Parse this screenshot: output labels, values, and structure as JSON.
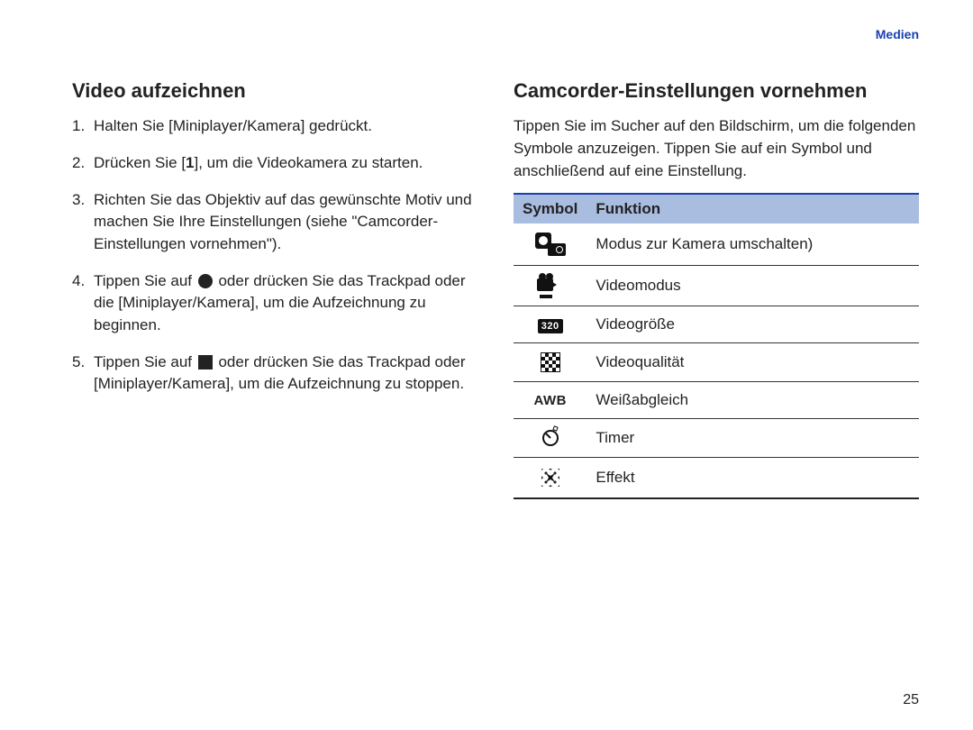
{
  "header": {
    "section_label": "Medien"
  },
  "left": {
    "heading": "Video aufzeichnen",
    "steps": [
      "Halten Sie [Miniplayer/Kamera] gedrückt.",
      "Drücken Sie [1], um die Videokamera zu starten.",
      "Richten Sie das Objektiv auf das gewünschte Motiv und machen Sie Ihre Einstellungen (siehe \"Camcorder-Einstellungen vornehmen\").",
      "Tippen Sie auf ● oder drücken Sie das Trackpad oder die [Miniplayer/Kamera], um die Aufzeichnung zu beginnen.",
      "Tippen Sie auf ■ oder drücken Sie das Trackpad oder [Miniplayer/Kamera], um die Aufzeichnung zu stoppen."
    ],
    "step4_parts": {
      "a": "Tippen Sie auf ",
      "b": " oder drücken Sie das Trackpad oder die [Miniplayer/Kamera], um die Aufzeichnung zu beginnen."
    },
    "step5_parts": {
      "a": "Tippen Sie auf ",
      "b": " oder drücken Sie das Trackpad oder [Miniplayer/Kamera], um die Aufzeichnung zu stoppen."
    }
  },
  "right": {
    "heading": "Camcorder-Einstellungen vornehmen",
    "intro": "Tippen Sie im Sucher auf den Bildschirm, um die folgenden Symbole anzuzeigen. Tippen Sie auf ein Symbol und anschließend auf eine Einstellung.",
    "table": {
      "headers": {
        "symbol": "Symbol",
        "function": "Funktion"
      },
      "rows": [
        {
          "icon": "mode-switch",
          "label": "Modus zur Kamera umschalten)"
        },
        {
          "icon": "video-mode",
          "label": "Videomodus"
        },
        {
          "icon": "video-size",
          "size_text": "320",
          "label": "Videogröße"
        },
        {
          "icon": "video-quality",
          "label": "Videoqualität"
        },
        {
          "icon": "white-balance",
          "awb_text": "AWB",
          "label": "Weißabgleich"
        },
        {
          "icon": "timer",
          "label": "Timer"
        },
        {
          "icon": "effect",
          "label": "Effekt"
        }
      ]
    }
  },
  "page_number": "25"
}
